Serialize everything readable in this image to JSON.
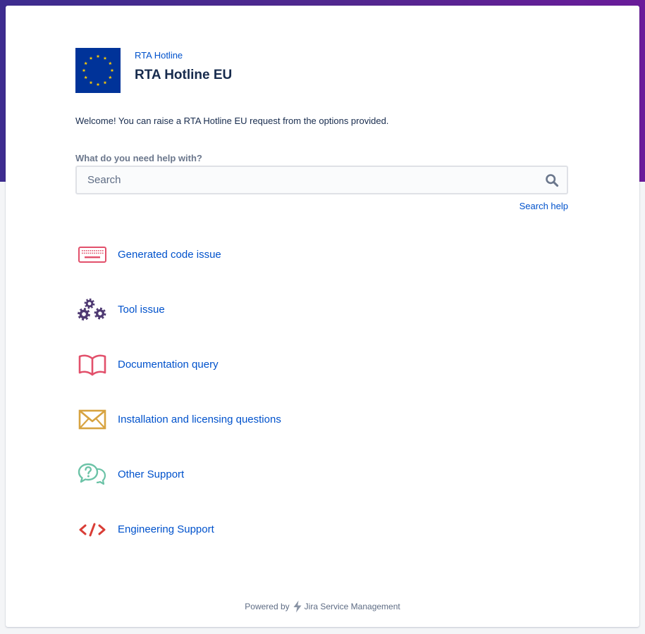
{
  "header": {
    "breadcrumb": "RTA Hotline",
    "title": "RTA Hotline EU"
  },
  "welcome": "Welcome! You can raise a RTA Hotline EU request from the options provided.",
  "search": {
    "label": "What do you need help with?",
    "placeholder": "Search",
    "help_link": "Search help"
  },
  "requests": [
    {
      "label": "Generated code issue",
      "icon": "keyboard-icon",
      "color": "#e2506b"
    },
    {
      "label": "Tool issue",
      "icon": "gears-icon",
      "color": "#4f3a73"
    },
    {
      "label": "Documentation query",
      "icon": "book-icon",
      "color": "#e2506b"
    },
    {
      "label": "Installation and licensing questions",
      "icon": "envelope-icon",
      "color": "#d7a340"
    },
    {
      "label": "Other Support",
      "icon": "question-bubbles-icon",
      "color": "#6cc3a7"
    },
    {
      "label": "Engineering Support",
      "icon": "code-icon",
      "color": "#d93d36"
    }
  ],
  "footer": {
    "powered_by": "Powered by",
    "product": "Jira Service Management"
  },
  "colors": {
    "link": "#0052cc",
    "text": "#172b4d",
    "banner_start": "#3d2c8f",
    "banner_end": "#6a1b9a",
    "flag_blue": "#003399",
    "flag_star": "#ffcc00"
  }
}
